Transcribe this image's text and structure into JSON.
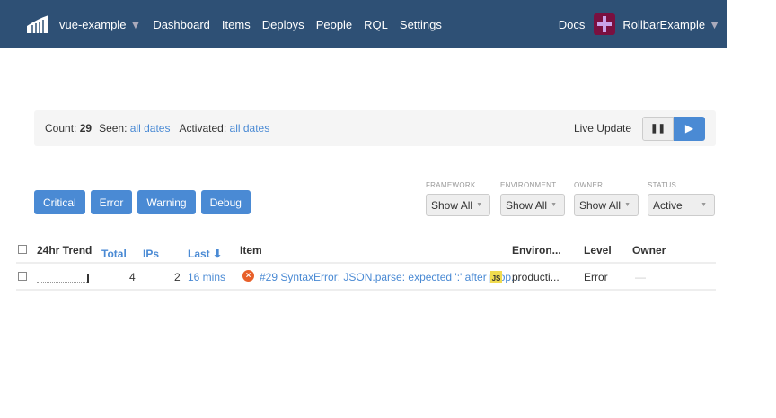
{
  "nav": {
    "project": "vue-example",
    "links": [
      "Dashboard",
      "Items",
      "Deploys",
      "People",
      "RQL",
      "Settings"
    ],
    "docs": "Docs",
    "account": "RollbarExample"
  },
  "summary": {
    "count_label": "Count:",
    "count": "29",
    "seen_label": "Seen:",
    "seen": "all dates",
    "activated_label": "Activated:",
    "activated": "all dates",
    "live_update": "Live Update"
  },
  "levels": [
    "Critical",
    "Error",
    "Warning",
    "Debug"
  ],
  "filters": [
    {
      "label": "FRAMEWORK",
      "value": "Show All"
    },
    {
      "label": "ENVIRONMENT",
      "value": "Show All"
    },
    {
      "label": "OWNER",
      "value": "Show All"
    },
    {
      "label": "STATUS",
      "value": "Active"
    }
  ],
  "table": {
    "headers": {
      "trend": "24hr Trend",
      "total": "Total",
      "ips": "IPs",
      "last": "Last ⬇",
      "item": "Item",
      "env": "Environ...",
      "level": "Level",
      "owner": "Owner"
    },
    "rows": [
      {
        "total": "4",
        "ips": "2",
        "last": "16 mins",
        "item": "#29 SyntaxError: JSON.parse: expected ':' after prop...",
        "lang": "JS",
        "env": "producti...",
        "level": "Error",
        "owner": "—"
      }
    ]
  }
}
